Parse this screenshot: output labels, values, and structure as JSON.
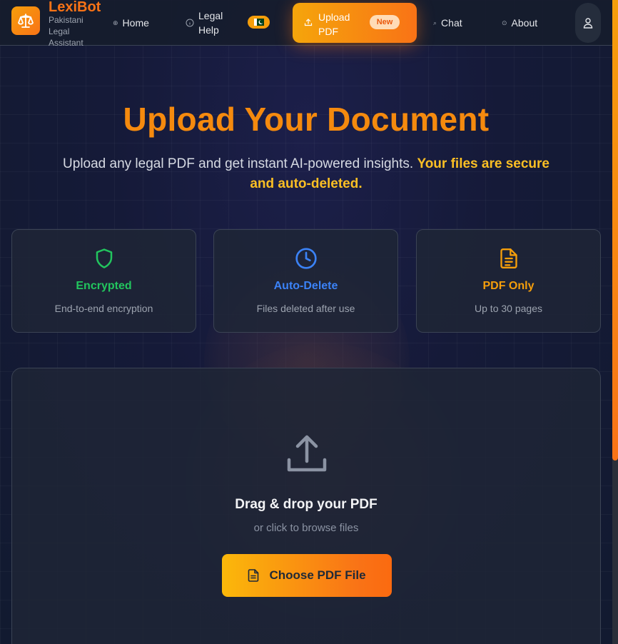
{
  "nav": {
    "brand_name": "LexiBot",
    "brand_tagline": "Pakistani Legal Assistant",
    "items": [
      {
        "label": "Home",
        "icon": "globe-icon"
      },
      {
        "label": "Legal Help",
        "icon": "info-icon"
      },
      {
        "label": "Upload PDF",
        "icon": "upload-icon",
        "active": true
      },
      {
        "label": "Chat",
        "icon": "chat-icon"
      },
      {
        "label": "About",
        "icon": "about-icon"
      }
    ],
    "flag_badge": "🇵🇰",
    "new_badge": "New",
    "user_icon": "user-icon"
  },
  "hero": {
    "title": "Upload Your Document",
    "subtitle": "Upload any legal PDF and get instant AI-powered insights.",
    "subtitle_highlight": "Your files are secure and auto-deleted."
  },
  "features": [
    {
      "title": "Encrypted",
      "description": "End-to-end encryption",
      "icon": "shield-icon",
      "color": "#22c55e"
    },
    {
      "title": "Auto-Delete",
      "description": "Files deleted after use",
      "icon": "clock-icon",
      "color": "#3b82f6"
    },
    {
      "title": "PDF Only",
      "description": "Up to 30 pages",
      "icon": "document-icon",
      "color": "#f59e0b"
    }
  ],
  "dropzone": {
    "title": "Drag & drop your PDF",
    "subtitle": "or click to browse files",
    "button_label": "Choose PDF File"
  },
  "colors": {
    "accent": "#f97316",
    "accent_light": "#f59e0b",
    "highlight": "#fbbf24"
  }
}
